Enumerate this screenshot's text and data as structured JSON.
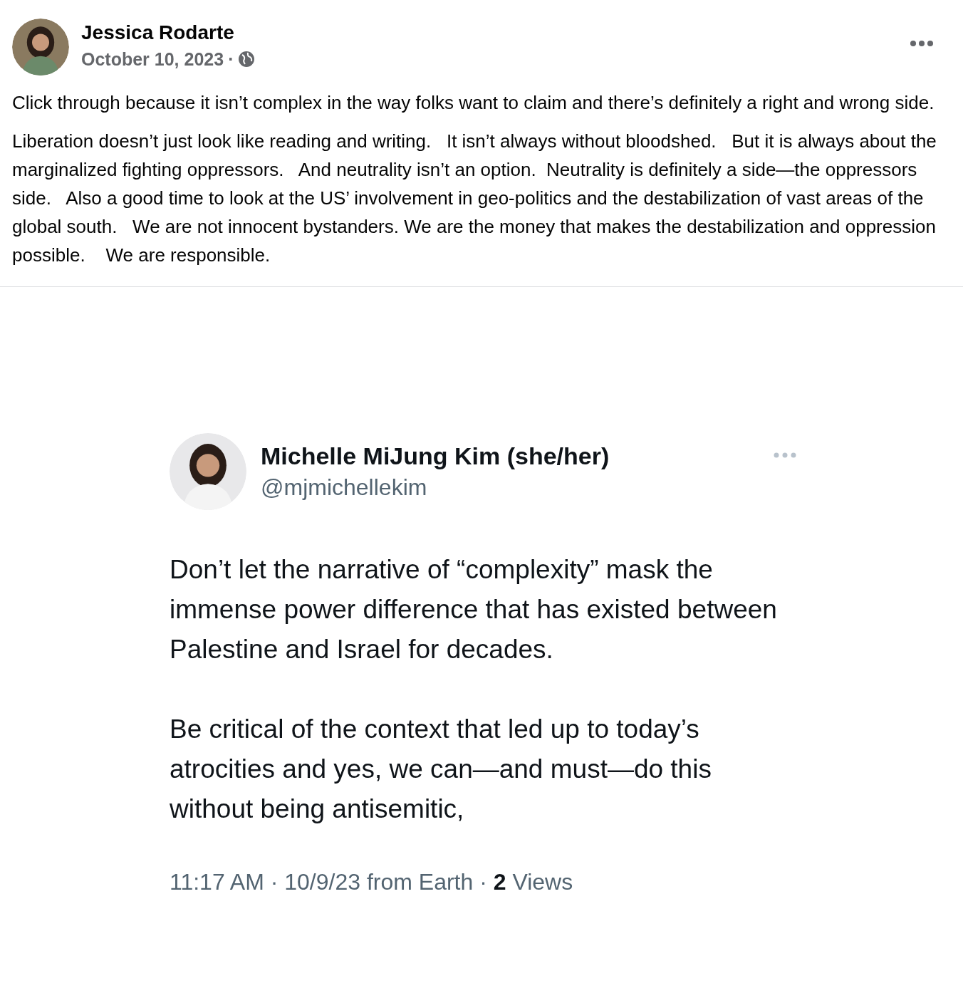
{
  "post": {
    "author": "Jessica Rodarte",
    "date": "October 10, 2023",
    "separator": "·",
    "paragraphs": [
      "Click through because it isn’t complex in the way folks want to claim and there’s definitely a right and wrong side.",
      "Liberation doesn’t just look like reading and writing.   It isn’t always without bloodshed.   But it is always about the marginalized fighting oppressors.   And neutrality isn’t an option.  Neutrality is definitely a side—the oppressors side.   Also a good time to look at the US’ involvement in geo-politics and the destabilization of vast areas of the global south.   We are not innocent bystanders. We are the money that makes the destabilization and oppression possible.    We are responsible."
    ]
  },
  "tweet": {
    "name": "Michelle MiJung Kim (she/her)",
    "handle": "@mjmichellekim",
    "paragraphs": [
      "Don’t let the narrative of “complexity” mask the immense power difference that has existed between Palestine and Israel for decades.",
      "Be critical of the context that led up to today’s atrocities and yes, we can—and must—do this without being antisemitic,"
    ],
    "footer": "11:17 AM · 10/9/23 from Earth · **2** Views"
  }
}
